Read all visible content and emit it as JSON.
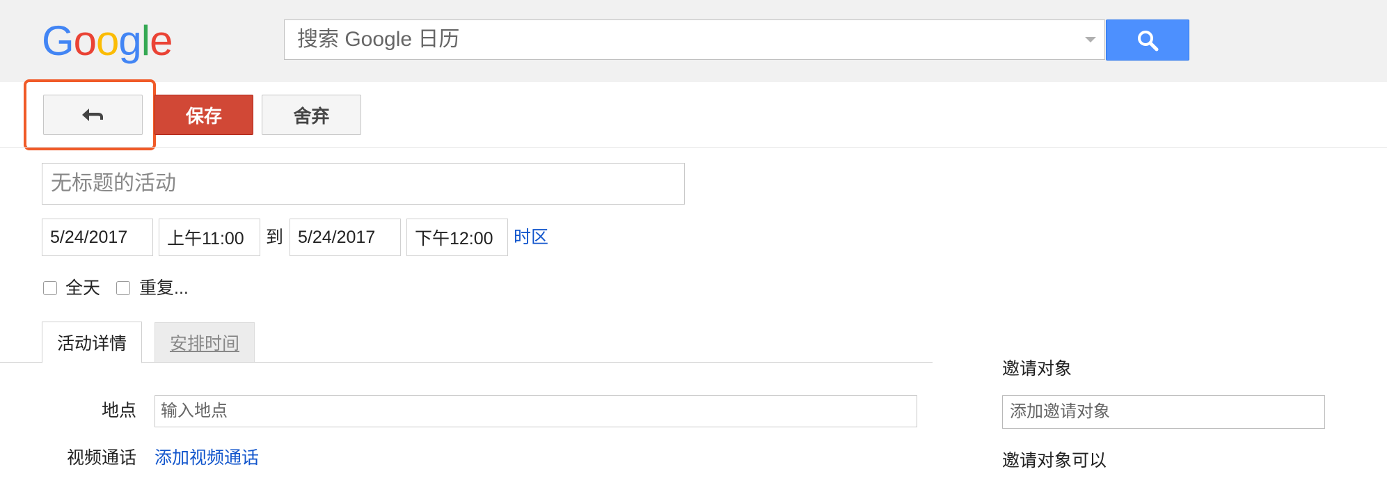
{
  "header": {
    "logo_text": "Google",
    "logo_letters": [
      "G",
      "o",
      "o",
      "g",
      "l",
      "e"
    ],
    "logo_colors": [
      "#4285f4",
      "#ea4335",
      "#fbbc05",
      "#4285f4",
      "#34a853",
      "#ea4335"
    ],
    "search": {
      "placeholder": "搜索 Google 日历",
      "value": ""
    },
    "search_button_icon": "search-icon",
    "dropdown_icon": "chevron-down-icon"
  },
  "toolbar": {
    "back_icon": "back-arrow-icon",
    "save_label": "保存",
    "discard_label": "舍弃",
    "save_color": "#d14836",
    "highlight_color": "#f05a28"
  },
  "event": {
    "title_placeholder": "无标题的活动",
    "start_date": "5/24/2017",
    "start_time": "上午11:00",
    "to_label": "到",
    "end_date": "5/24/2017",
    "end_time": "下午12:00",
    "timezone_link": "时区",
    "all_day_label": "全天",
    "repeat_label": "重复..."
  },
  "tabs": [
    {
      "label": "活动详情",
      "active": true
    },
    {
      "label": "安排时间",
      "active": false
    }
  ],
  "details": {
    "location_label": "地点",
    "location_placeholder": "输入地点",
    "video_label": "视频通话",
    "video_link": "添加视频通话"
  },
  "guests": {
    "heading": "邀请对象",
    "input_placeholder": "添加邀请对象",
    "permissions_heading": "邀请对象可以"
  },
  "colors": {
    "link": "#1155cc",
    "search_button": "#4d90fe"
  }
}
